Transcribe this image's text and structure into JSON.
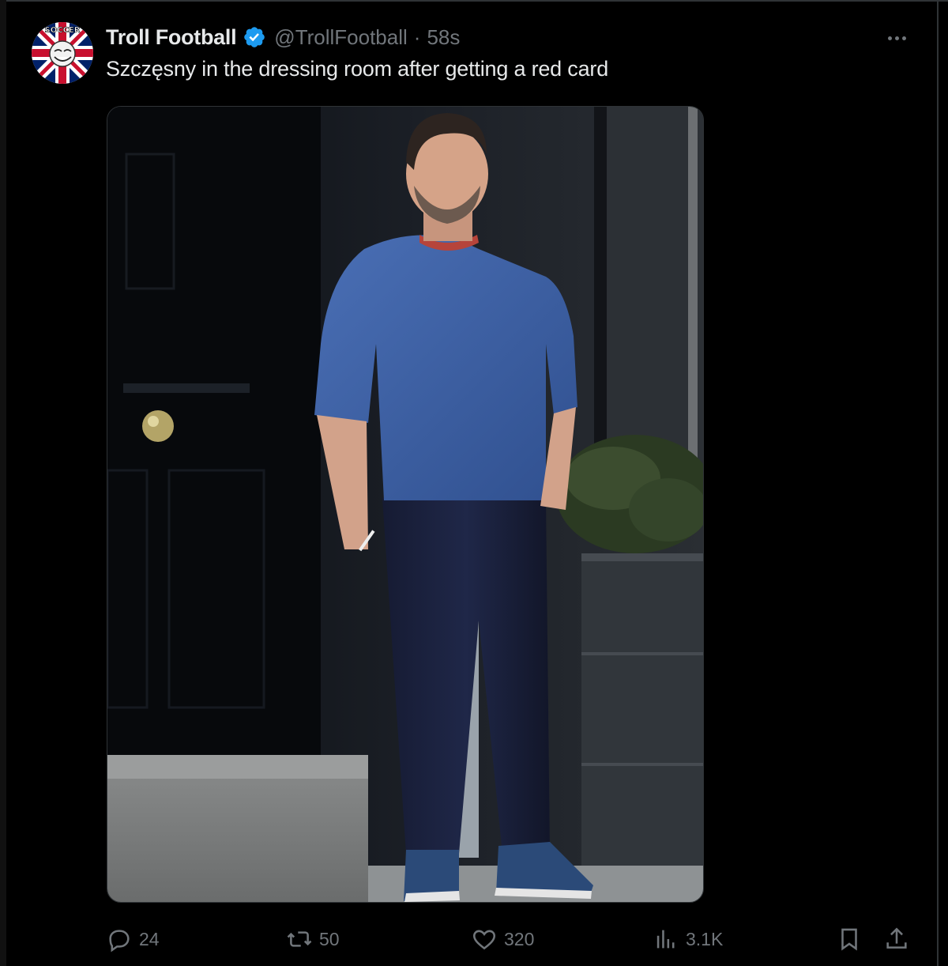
{
  "tweet": {
    "author": {
      "display_name": "Troll Football",
      "handle": "@TrollFootball",
      "verified": true,
      "avatar_text": "SOCCER"
    },
    "time": "58s",
    "text": "Szczęsny in the dressing room after getting a red card",
    "media": {
      "kind": "photo"
    },
    "actions": {
      "replies": "24",
      "reposts": "50",
      "likes": "320",
      "views": "3.1K"
    }
  },
  "colors": {
    "background": "#000000",
    "primary_text": "#e7e9ea",
    "secondary_text": "#71767b",
    "verified": "#1d9bf0",
    "border": "#2f3336"
  },
  "icons": {
    "reply": "reply-bubble-icon",
    "repost": "repost-arrows-icon",
    "like": "heart-icon",
    "views": "bar-chart-icon",
    "bookmark": "bookmark-icon",
    "share": "share-upload-icon",
    "more": "more-dots-icon",
    "verified": "verified-badge-icon"
  }
}
